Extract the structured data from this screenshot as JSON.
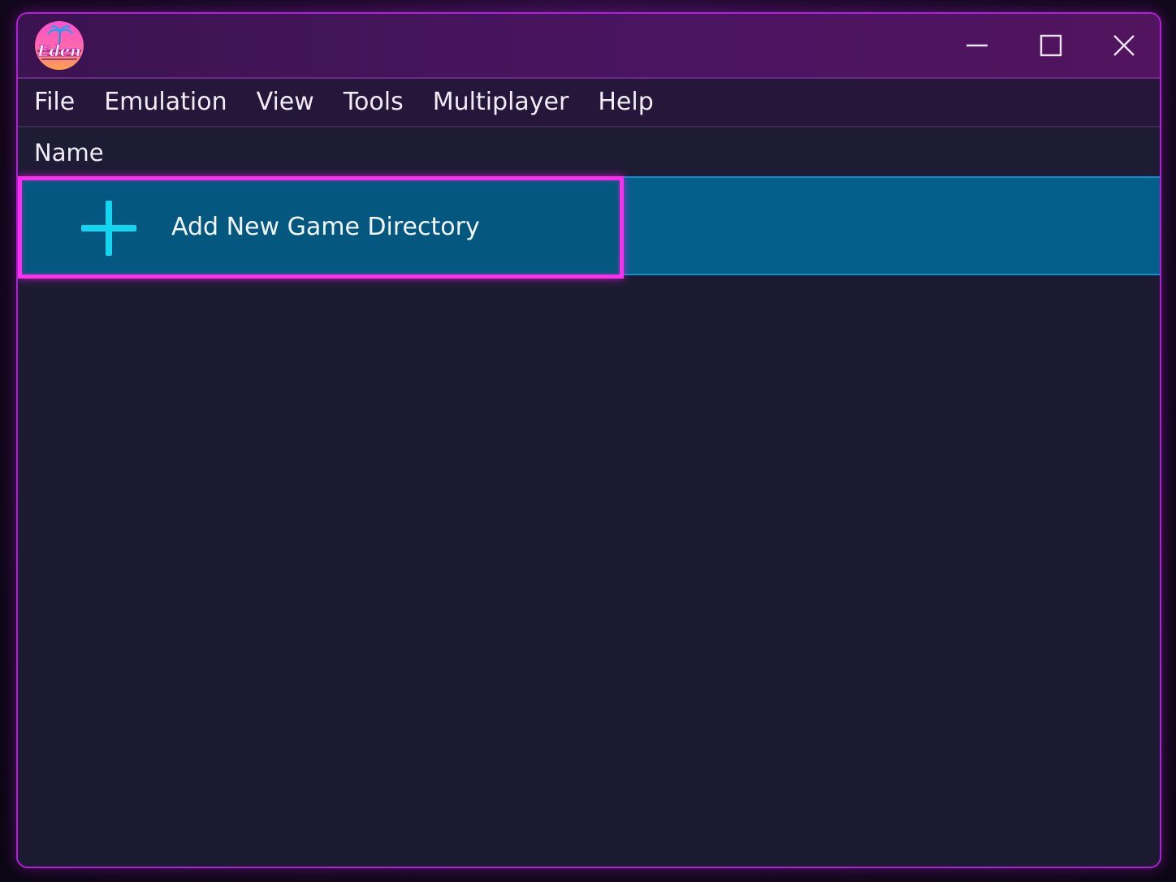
{
  "app": {
    "logo_text": "Eden",
    "icons": {
      "logo": "eden-logo-icon",
      "minimize": "minimize-icon",
      "maximize": "maximize-icon",
      "close": "close-icon",
      "add": "plus-icon"
    }
  },
  "menubar": {
    "items": [
      "File",
      "Emulation",
      "View",
      "Tools",
      "Multiplayer",
      "Help"
    ]
  },
  "list": {
    "header_name": "Name",
    "add_dir_label": "Add New Game Directory"
  },
  "colors": {
    "accent_magenta": "#ff2df0",
    "accent_cyan": "#12d6f0",
    "row_selected": "#045e8a",
    "background": "#1b1a31"
  }
}
